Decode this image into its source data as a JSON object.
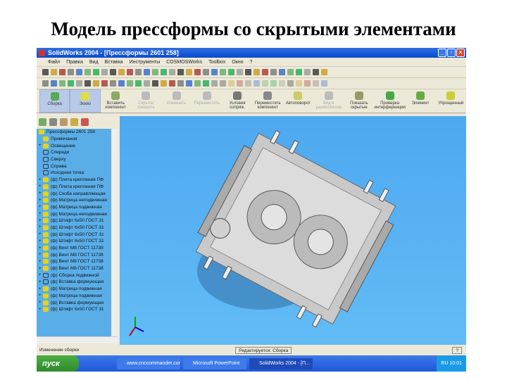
{
  "slide": {
    "title": "Модель прессформы со скрытыми элементами"
  },
  "window": {
    "title": "SolidWorks 2004 - [Прессформы 2601 258]"
  },
  "menu": [
    "Файл",
    "Правка",
    "Вид",
    "Вставка",
    "Инструменты",
    "COSMOSWorks",
    "Toolbox",
    "Окно",
    "?"
  ],
  "command_manager": [
    "Сборка",
    "Эскиз",
    "Вставить компонент",
    "Скрыть/показать",
    "Изменить",
    "Переместить",
    "Условия сопряж.",
    "Переместить компонент",
    "Автоповорот",
    "Вид в разнесенном",
    "Показать скрытые",
    "Проверка интерференции",
    "Элемент",
    "Упрощенный"
  ],
  "tree": {
    "root": "Прессформы 2601 258",
    "items": [
      "Примечания",
      "Освещение",
      "Спереди",
      "Сверху",
      "Справа",
      "Исходная точка",
      "(ф) Плита крепления ПФ",
      "(ф) Плита крепления ПФ",
      "(ф) Скоба направляющая",
      "(ф) Матрица неподвижная",
      "(ф) Матрица подвижная",
      "(ф) Матрица неподвижная",
      "(ф) Штифт 6x50 ГОСТ 31",
      "(ф) Штифт 6x50 ГОСТ 31",
      "(ф) Штифт 6x50 ГОСТ 31",
      "(ф) Штифт 6x50 ГОСТ 31",
      "(ф) Винт М8 ГОСТ 11738",
      "(ф) Винт М8 ГОСТ 11738",
      "(ф) Винт М8 ГОСТ 11738",
      "(ф) Винт М8 ГОСТ 11738",
      "(ф) Сборка подвижной",
      "(ф) Вставка формующая",
      "(ф) Матрица подвижная",
      "(ф) Матрица подвижная",
      "(ф) Вставка формующая",
      "(ф) Штифт 6x50 ГОСТ 31"
    ]
  },
  "status": {
    "left": "Изменение сборки",
    "right": "Редактируется: Сборка",
    "help": "?"
  },
  "taskbar": {
    "start": "пуск",
    "tasks": [
      "www.cnccommander.com",
      "Microsoft PowerPoint",
      "SolidWorks 2004 - [П..."
    ],
    "clock": "10:01",
    "lang": "RU"
  }
}
